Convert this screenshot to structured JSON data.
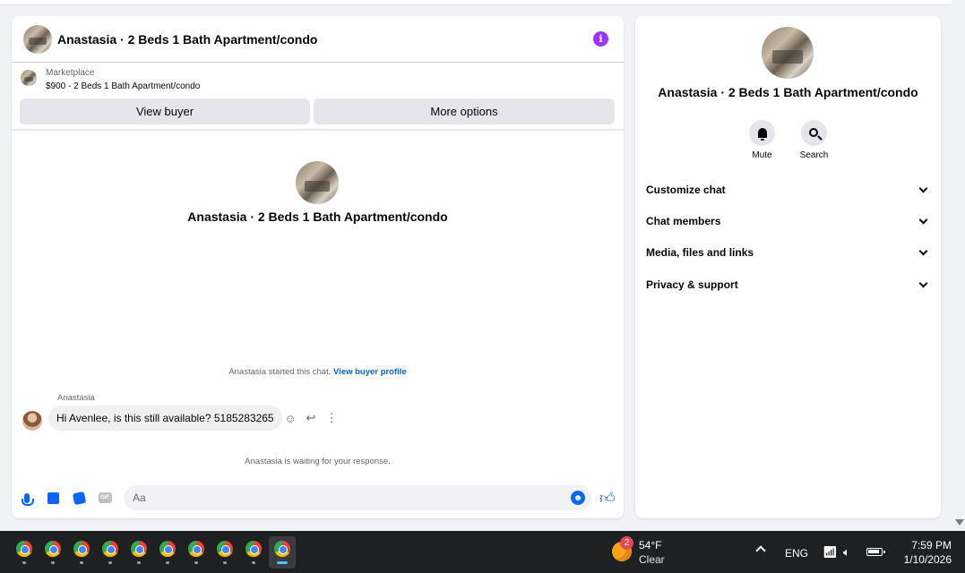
{
  "chat": {
    "title": "Anastasia · 2 Beds 1 Bath Apartment/condo",
    "info_icon": "i",
    "marketplace": {
      "label": "Marketplace",
      "listing": "$900 - 2 Beds 1 Bath Apartment/condo"
    },
    "buttons": {
      "view_buyer": "View buyer",
      "more_options": "More options"
    },
    "intro_title": "Anastasia · 2 Beds 1 Bath Apartment/condo",
    "started_text": "Anastasia started this chat.",
    "started_link": "View buyer profile",
    "message": {
      "sender": "Anastasia",
      "text": "Hi Avenlee, is this still available? 5185283265"
    },
    "message_actions": [
      "smile-icon",
      "reply-icon",
      "more-icon"
    ],
    "waiting_text": "Anastasia is waiting for your response.",
    "composer": {
      "placeholder": "Aa",
      "icons": [
        "microphone-icon",
        "photo-icon",
        "sticker-icon",
        "gif-icon",
        "emoji-icon",
        "thumbs-up-icon"
      ],
      "gif_label": "GIF"
    }
  },
  "side": {
    "title": "Anastasia · 2 Beds 1 Bath Apartment/condo",
    "actions": [
      {
        "label": "Mute",
        "icon": "bell-icon"
      },
      {
        "label": "Search",
        "icon": "search-icon"
      }
    ],
    "sections": [
      "Customize chat",
      "Chat members",
      "Media, files and links",
      "Privacy & support"
    ]
  },
  "taskbar": {
    "app_icon": "chrome-icon",
    "app_count": 10,
    "weather": {
      "badge": "2",
      "temp": "54°F",
      "condition": "Clear"
    },
    "language": "ENG",
    "time": "7:59 PM",
    "date": "1/10/2026"
  },
  "colors": {
    "accent_blue": "#0866ff",
    "info_purple": "#a033ff",
    "link_blue": "#0064d1",
    "taskbar_bg": "#1f2022"
  }
}
